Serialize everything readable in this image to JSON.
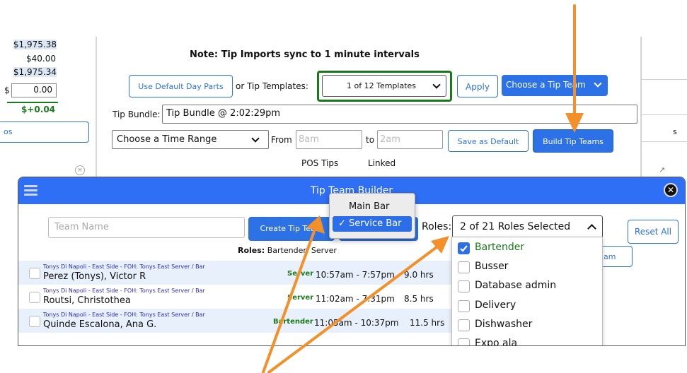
{
  "left_panel": {
    "amount_1": "$1,975.38",
    "amount_2": "$40.00",
    "amount_3": "$1,975.34",
    "currency": "$",
    "input_value": "0.00",
    "difference": "$+0.04",
    "button_partial": "os"
  },
  "main_panel": {
    "note": "Note: Tip Imports sync to 1 minute intervals",
    "use_default_day_parts": "Use Default Day Parts",
    "or_tip_templates": "or Tip Templates:",
    "template_select": "1 of 12 Templates",
    "apply": "Apply",
    "choose_tip_team": "Choose a Tip Team",
    "tip_bundle_label": "Tip Bundle:",
    "tip_bundle_value": "Tip Bundle @ 2:02:29pm",
    "time_range_select": "Choose a Time Range",
    "from_label": "From",
    "from_placeholder": "8am",
    "to_label": "to",
    "to_placeholder": "2am",
    "save_as_default": "Save as Default",
    "build_tip_teams": "Build Tip Teams",
    "pos_tips": "POS Tips",
    "linked": "Linked",
    "right_col_partial": "s"
  },
  "modal": {
    "title": "Tip Team Builder",
    "team_name_placeholder": "Team Name",
    "create_tip_team": "Create Tip Team",
    "roles_label": "Roles:",
    "roles_select": "2 of 21 Roles Selected",
    "reset_all": "Reset All",
    "partial_button": "am",
    "roles_summary_label": "Roles:",
    "roles_summary_value": "Bartender, Server",
    "staff": [
      {
        "location": "Tonys Di Napoli - East Side - FOH: Tonys East Server / Bar",
        "name": "Perez (Tonys), Victor R",
        "role": "Server",
        "shift": "10:57am - 7:57pm",
        "hours": "9.0 hrs"
      },
      {
        "location": "Tonys Di Napoli - East Side - FOH: Tonys East Server / Bar",
        "name": "Routsi, Christothea",
        "role": "Server",
        "shift": "11:02am - 7:31pm",
        "hours": "8.5 hrs"
      },
      {
        "location": "Tonys Di Napoli - East Side - FOH: Tonys East Server / Bar",
        "name": "Quinde Escalona, Ana G.",
        "role": "Bartender",
        "shift": "11:05am - 10:37pm",
        "hours": "11.5 hrs"
      }
    ],
    "role_options": [
      {
        "label": "Bartender",
        "checked": "true",
        "color": "#1b7a1b"
      },
      {
        "label": "Busser",
        "checked": "false"
      },
      {
        "label": "Database admin",
        "checked": "false"
      },
      {
        "label": "Delivery",
        "checked": "false"
      },
      {
        "label": "Dishwasher",
        "checked": "false"
      },
      {
        "label": "Expo ala",
        "checked": "false"
      }
    ]
  },
  "team_popup": {
    "items": [
      "Main Bar",
      "Service Bar"
    ],
    "selected": "Service Bar",
    "check": "✓"
  },
  "colors": {
    "accent": "#2c72e6",
    "header": "#2e6ff5",
    "highlight_border": "#167a16",
    "annotation_arrow": "#f4902a"
  },
  "icons": [
    "hamburger-icon",
    "close-icon",
    "chevron-down-icon",
    "chevron-up-icon",
    "check-icon",
    "resize-icon"
  ]
}
